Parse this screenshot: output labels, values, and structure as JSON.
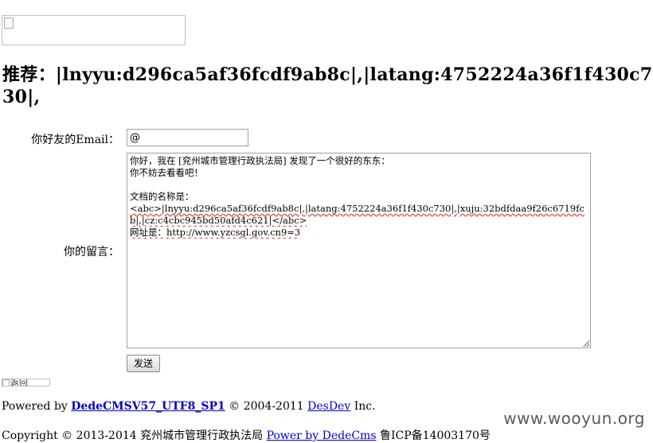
{
  "header": {
    "title": "推荐：|lnyyu:d296ca5af36fcdf9ab8c|,|latang:4752224a36f1f430c730|,"
  },
  "form": {
    "email_label": "你好友的Email：",
    "email_value": "@",
    "message_label": "你的留言：",
    "message_lines": [
      "你好，我在 [兖州城市管理行政执法局] 发现了一个很好的东东：",
      "你不妨去看看吧！",
      "",
      "文档的名称是：",
      "<abc>|lnyyu:d296ca5af36fcdf9ab8c|,|latang:4752224a36f1f430c730|,|xuju:32bdfdaa9f26c6719fcb|,|cz:c4cbc945bd50afd4c621|</abc>",
      "网址是：http://www.yzcsgl.gov.cn9=3"
    ],
    "send_label": "发送"
  },
  "back": {
    "alt_text": "返回"
  },
  "footer": {
    "powered_prefix": "Powered by ",
    "dedecms_link": "DedeCMSV57_UTF8_SP1",
    "powered_mid": " © 2004-2011 ",
    "desdev_link": "DesDev",
    "powered_suffix": " Inc.",
    "copyright_prefix": "Copyright © 2013-2014 兖州城市管理行政执法局 ",
    "powered_by_link": "Power by DedeCms",
    "icp": "  鲁ICP备14003170号"
  },
  "watermark": "www.wooyun.org"
}
